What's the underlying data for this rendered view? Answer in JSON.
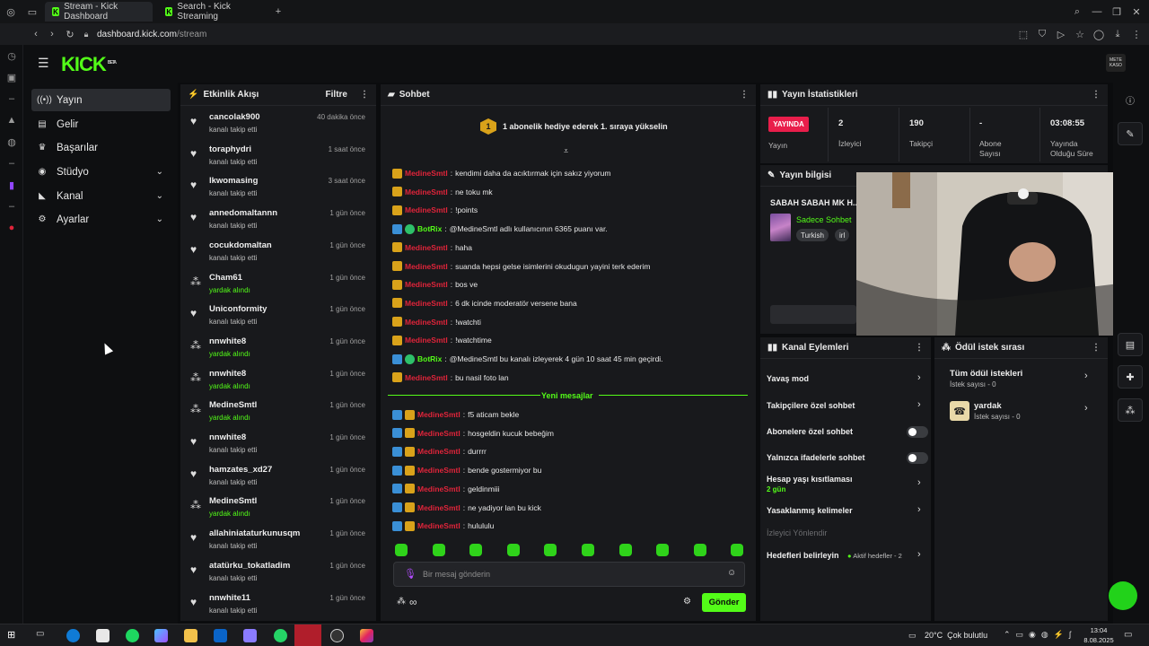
{
  "browser": {
    "tabs": [
      {
        "label": "Stream - Kick Dashboard",
        "active": true
      },
      {
        "label": "Search - Kick Streaming",
        "active": false
      }
    ],
    "url_host": "dashboard.kick.com",
    "url_path": "/stream"
  },
  "app": {
    "logo": "KICK",
    "logo_tag": "BETA",
    "avatar_text": "METE KASO"
  },
  "sidebar": {
    "items": [
      {
        "label": "Yayın",
        "icon": "broadcast-icon",
        "active": true
      },
      {
        "label": "Gelir",
        "icon": "wallet-icon"
      },
      {
        "label": "Başarılar",
        "icon": "trophy-icon"
      },
      {
        "label": "Stüdyo",
        "icon": "studio-icon",
        "expandable": true
      },
      {
        "label": "Kanal",
        "icon": "channel-icon",
        "expandable": true
      },
      {
        "label": "Ayarlar",
        "icon": "gear-icon",
        "expandable": true
      }
    ]
  },
  "activity": {
    "title": "Etkinlik Akışı",
    "filter_label": "Filtre",
    "events": [
      {
        "name": "cancolak900",
        "desc": "kanalı takip etti",
        "time": "40 dakika önce",
        "type": "follow"
      },
      {
        "name": "toraphydri",
        "desc": "kanalı takip etti",
        "time": "1 saat önce",
        "type": "follow"
      },
      {
        "name": "lkwomasing",
        "desc": "kanalı takip etti",
        "time": "3 saat önce",
        "type": "follow"
      },
      {
        "name": "annedomaltannn",
        "desc": "kanalı takip etti",
        "time": "1 gün önce",
        "type": "follow"
      },
      {
        "name": "cocukdomaltan",
        "desc": "kanalı takip etti",
        "time": "1 gün önce",
        "type": "follow"
      },
      {
        "name": "Cham61",
        "desc": "yardak alındı",
        "time": "1 gün önce",
        "type": "reward"
      },
      {
        "name": "Uniconformity",
        "desc": "kanalı takip etti",
        "time": "1 gün önce",
        "type": "follow"
      },
      {
        "name": "nnwhite8",
        "desc": "yardak alındı",
        "time": "1 gün önce",
        "type": "reward"
      },
      {
        "name": "nnwhite8",
        "desc": "yardak alındı",
        "time": "1 gün önce",
        "type": "reward"
      },
      {
        "name": "MedineSmtl",
        "desc": "yardak alındı",
        "time": "1 gün önce",
        "type": "reward"
      },
      {
        "name": "nnwhite8",
        "desc": "kanalı takip etti",
        "time": "1 gün önce",
        "type": "follow"
      },
      {
        "name": "hamzates_xd27",
        "desc": "kanalı takip etti",
        "time": "1 gün önce",
        "type": "follow"
      },
      {
        "name": "MedineSmtl",
        "desc": "yardak alındı",
        "time": "1 gün önce",
        "type": "reward"
      },
      {
        "name": "allahiniataturkunusqm",
        "desc": "kanalı takip etti",
        "time": "1 gün önce",
        "type": "follow"
      },
      {
        "name": "atatürku_tokatladim",
        "desc": "kanalı takip etti",
        "time": "1 gün önce",
        "type": "follow"
      },
      {
        "name": "nnwhite11",
        "desc": "kanalı takip etti",
        "time": "1 gün önce",
        "type": "follow"
      }
    ]
  },
  "chat": {
    "title": "Sohbet",
    "banner_rank": "1",
    "banner_text": "1 abonelik hediye ederek 1. sıraya yükselin",
    "new_messages_label": "Yeni mesajlar",
    "messages_old": [
      {
        "user": "MedineSmtl",
        "text": "kendimi daha da acıktırmak için sakız yiyorum",
        "badges": [
          "crown"
        ]
      },
      {
        "user": "MedineSmtl",
        "text": "ne toku mk",
        "badges": [
          "crown"
        ]
      },
      {
        "user": "MedineSmtl",
        "text": "!points",
        "badges": [
          "crown"
        ]
      },
      {
        "user": "BotRix",
        "text": "@MedineSmtl adlı kullanıcının 6365 puanı var.",
        "badges": [
          "mod",
          "bot"
        ],
        "bot": true
      },
      {
        "user": "MedineSmtl",
        "text": "haha",
        "badges": [
          "crown"
        ]
      },
      {
        "user": "MedineSmtl",
        "text": "suanda hepsi gelse isimlerini okudugun yayini terk ederim",
        "badges": [
          "crown"
        ]
      },
      {
        "user": "MedineSmtl",
        "text": "bos ve",
        "badges": [
          "crown"
        ]
      },
      {
        "user": "MedineSmtl",
        "text": "6 dk icinde moderatör versene bana",
        "badges": [
          "crown"
        ]
      },
      {
        "user": "MedineSmtl",
        "text": "!watchti",
        "badges": [
          "crown"
        ]
      },
      {
        "user": "MedineSmtl",
        "text": "!watchtime",
        "badges": [
          "crown"
        ]
      },
      {
        "user": "BotRix",
        "text": "@MedineSmtl bu kanalı izleyerek 4 gün 10 saat 45 min geçirdi.",
        "badges": [
          "mod",
          "bot"
        ],
        "bot": true
      },
      {
        "user": "MedineSmtl",
        "text": "bu nasil foto lan",
        "badges": [
          "crown"
        ]
      }
    ],
    "messages_new": [
      {
        "user": "MedineSmtl",
        "text": "f5 aticam bekle",
        "badges": [
          "mod",
          "crown"
        ]
      },
      {
        "user": "MedineSmtl",
        "text": "hosgeldin kucuk bebeğim",
        "badges": [
          "mod",
          "crown"
        ]
      },
      {
        "user": "MedineSmtl",
        "text": "durrrr",
        "badges": [
          "mod",
          "crown"
        ]
      },
      {
        "user": "MedineSmtl",
        "text": "bende gostermiyor bu",
        "badges": [
          "mod",
          "crown"
        ]
      },
      {
        "user": "MedineSmtl",
        "text": "geldinmiii",
        "badges": [
          "mod",
          "crown"
        ]
      },
      {
        "user": "MedineSmtl",
        "text": "ne yadiyor lan bu kick",
        "badges": [
          "mod",
          "crown"
        ]
      },
      {
        "user": "MedineSmtl",
        "text": "hulululu",
        "badges": [
          "mod",
          "crown"
        ]
      }
    ],
    "input_placeholder": "Bir mesaj gönderin",
    "send_label": "Gönder",
    "points_symbol": "∞"
  },
  "stats": {
    "title": "Yayın İstatistikleri",
    "live_label": "YAYINDA",
    "live_sub": "Yayın",
    "cells": [
      {
        "value": "2",
        "label": "İzleyici"
      },
      {
        "value": "190",
        "label": "Takipçi"
      },
      {
        "value": "-",
        "label": "Abone Sayısı"
      },
      {
        "value": "03:08:55",
        "label": "Yayında Olduğu Süre"
      }
    ]
  },
  "stream_info": {
    "title": "Yayın bilgisi",
    "stream_title": "SABAH SABAH MK H...",
    "category": "Sadece Sohbet",
    "tags": [
      "Turkish",
      "irl"
    ]
  },
  "channel_actions": {
    "title": "Kanal Eylemleri",
    "items": [
      {
        "label": "Yavaş mod",
        "control": "chevron"
      },
      {
        "label": "Takipçilere özel sohbet",
        "control": "chevron"
      },
      {
        "label": "Abonelere özel sohbet",
        "control": "toggle"
      },
      {
        "label": "Yalnızca ifadelerle sohbet",
        "control": "toggle"
      },
      {
        "label": "Hesap yaşı kısıtlaması",
        "sub": "2 gün",
        "control": "chevron"
      },
      {
        "label": "Yasaklanmış kelimeler",
        "control": "chevron"
      },
      {
        "label": "İzleyici Yönlendir",
        "control": "none",
        "disabled": true
      },
      {
        "label": "Hedefleri belirleyin",
        "sub_inline": "Aktif hedefler - 2",
        "control": "chevron"
      }
    ]
  },
  "rewards": {
    "title": "Ödül istek sırası",
    "items": [
      {
        "label": "Tüm ödül istekleri",
        "sub": "İstek sayısı - 0"
      },
      {
        "label": "yardak",
        "sub": "İstek sayısı - 0"
      }
    ]
  },
  "taskbar": {
    "weather": "20°C  Çok bulutlu",
    "time": "13:04",
    "date": "8.08.2025"
  },
  "colors": {
    "brand": "#53fc18",
    "live": "#e91e4b",
    "username": "#e0243a"
  }
}
